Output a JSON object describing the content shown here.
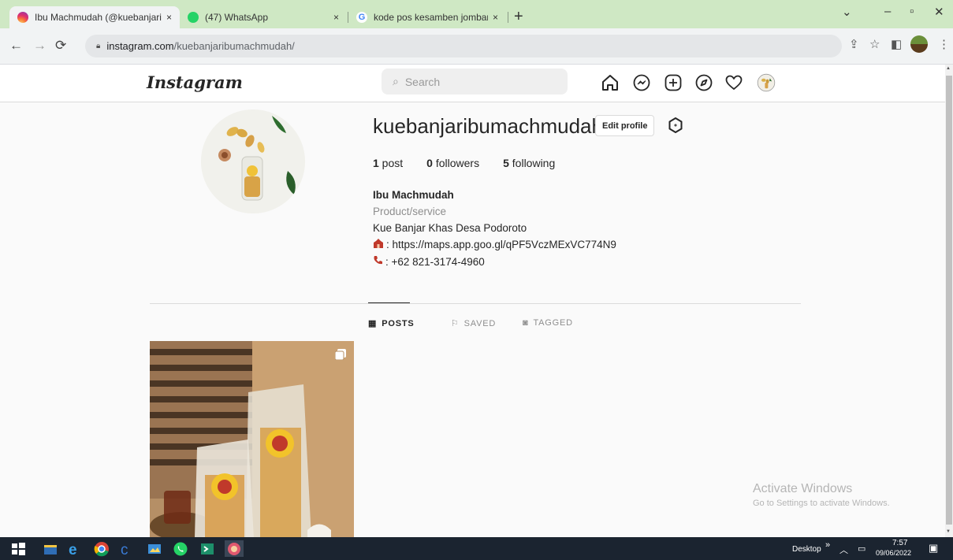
{
  "browser": {
    "tabs": [
      {
        "title": "Ibu Machmudah (@kuebanjaribu",
        "close": "×",
        "favicon": "instagram-icon",
        "active": true
      },
      {
        "title": "(47) WhatsApp",
        "close": "×",
        "favicon": "whatsapp-icon",
        "active": false
      },
      {
        "title": "kode pos kesamben jombang - P",
        "close": "×",
        "favicon": "google-icon",
        "active": false
      }
    ],
    "new_tab": "+",
    "url_host": "instagram.com",
    "url_path": "/kuebanjaribumachmudah/",
    "window_controls": [
      "⌄",
      "–",
      "▫",
      "✕"
    ]
  },
  "instagram": {
    "logo": "Instagram",
    "search_placeholder": "Search",
    "nav_icons": [
      "home-icon",
      "messenger-icon",
      "new-post-icon",
      "explore-icon",
      "activity-heart-icon",
      "profile-avatar-icon"
    ],
    "profile": {
      "username": "kuebanjaribumachmudah",
      "edit_profile": "Edit profile",
      "stats": {
        "posts_count": "1",
        "posts_label": " post",
        "followers_count": "0",
        "followers_label": " followers",
        "following_count": "5",
        "following_label": " following"
      },
      "full_name": "Ibu Machmudah",
      "category": "Product/service",
      "bio_line1": "Kue Banjar Khas Desa Podoroto",
      "bio_line2": ": https://maps.app.goo.gl/qPF5VczMExVC774N9",
      "bio_line3": ": +62 821-3174-4960"
    },
    "tabs": [
      {
        "label": "POSTS",
        "icon": "grid-icon",
        "active": true
      },
      {
        "label": "SAVED",
        "icon": "bookmark-icon",
        "active": false
      },
      {
        "label": "TAGGED",
        "icon": "tag-icon",
        "active": false
      }
    ]
  },
  "activation": {
    "title": "Activate Windows",
    "subtitle": "Go to Settings to activate Windows."
  },
  "taskbar": {
    "desktop_label": "Desktop",
    "chevron": "»",
    "time": "7:57",
    "date": "09/06/2022"
  },
  "colors": {
    "tabstrip": "#cfe8c4",
    "ig_background": "#fafafa",
    "taskbar": "#1b2430"
  }
}
